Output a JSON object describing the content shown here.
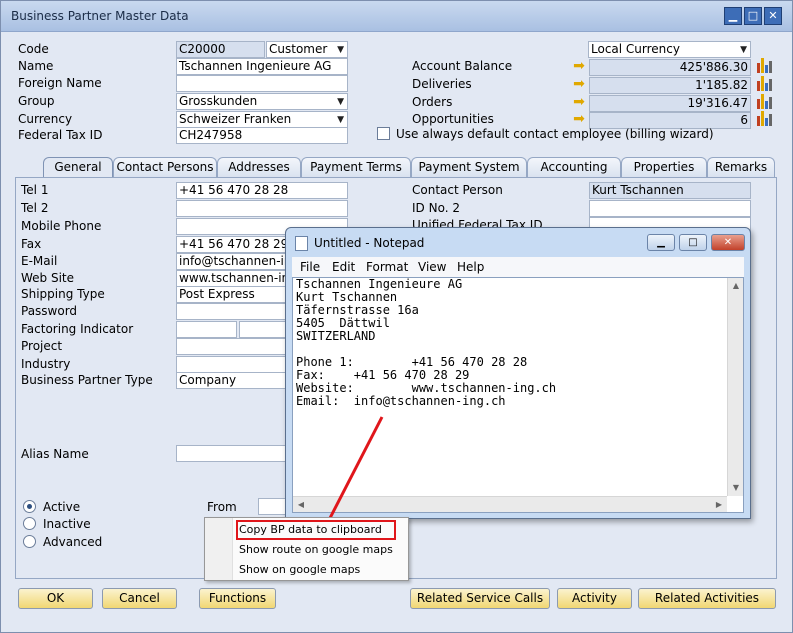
{
  "window": {
    "title": "Business Partner Master Data"
  },
  "header": {
    "code_label": "Code",
    "code_value": "C20000",
    "code_type": "Customer",
    "name_label": "Name",
    "name_value": "Tschannen Ingenieure AG",
    "foreign_name_label": "Foreign Name",
    "foreign_name_value": "",
    "group_label": "Group",
    "group_value": "Grosskunden",
    "currency_label": "Currency",
    "currency_value": "Schweizer Franken",
    "tax_id_label": "Federal Tax ID",
    "tax_id_value": "CH247958",
    "local_currency": "Local Currency",
    "account_balance_label": "Account Balance",
    "account_balance_value": "425'886.30",
    "deliveries_label": "Deliveries",
    "deliveries_value": "1'185.82",
    "orders_label": "Orders",
    "orders_value": "19'316.47",
    "opportunities_label": "Opportunities",
    "opportunities_value": "6",
    "default_contact_label": "Use always default contact employee (billing wizard)"
  },
  "tabs": [
    "General",
    "Contact Persons",
    "Addresses",
    "Payment Terms",
    "Payment System",
    "Accounting",
    "Properties",
    "Remarks"
  ],
  "general": {
    "tel1_label": "Tel 1",
    "tel1_value": "+41 56 470 28 28",
    "tel2_label": "Tel 2",
    "mobile_label": "Mobile Phone",
    "fax_label": "Fax",
    "fax_value": "+41 56 470 28 29",
    "email_label": "E-Mail",
    "email_value": "info@tschannen-ing",
    "website_label": "Web Site",
    "website_value": "www.tschannen-ing",
    "shipping_label": "Shipping Type",
    "shipping_value": "Post Express",
    "password_label": "Password",
    "factoring_label": "Factoring Indicator",
    "project_label": "Project",
    "industry_label": "Industry",
    "bp_type_label": "Business Partner Type",
    "bp_type_value": "Company",
    "alias_label": "Alias Name",
    "contact_person_label": "Contact Person",
    "contact_person_value": "Kurt Tschannen",
    "id_no2_label": "ID No. 2",
    "unified_tax_label": "Unified Federal Tax ID",
    "status_active": "Active",
    "status_inactive": "Inactive",
    "status_advanced": "Advanced",
    "from_label": "From"
  },
  "buttons": {
    "ok": "OK",
    "cancel": "Cancel",
    "functions": "Functions",
    "related_service_calls": "Related Service Calls",
    "activity": "Activity",
    "related_activities": "Related Activities"
  },
  "context_menu": [
    "Copy BP data to clipboard",
    "Show route on google maps",
    "Show on google maps"
  ],
  "notepad": {
    "title": "Untitled - Notepad",
    "menu": [
      "File",
      "Edit",
      "Format",
      "View",
      "Help"
    ],
    "content": "Tschannen Ingenieure AG\nKurt Tschannen\nTäfernstrasse 16a\n5405  Dättwil\nSWITZERLAND\n\nPhone 1:        +41 56 470 28 28\nFax:    +41 56 470 28 29\nWebsite:        www.tschannen-ing.ch\nEmail:  info@tschannen-ing.ch"
  },
  "colors": {
    "highlight_box": "#e0161b",
    "arrow_line": "#e0161b",
    "button_gold": "#f1d773"
  },
  "icons": {
    "link_arrow": "yellow-arrow-icon",
    "chart": "bar-chart-icon"
  }
}
